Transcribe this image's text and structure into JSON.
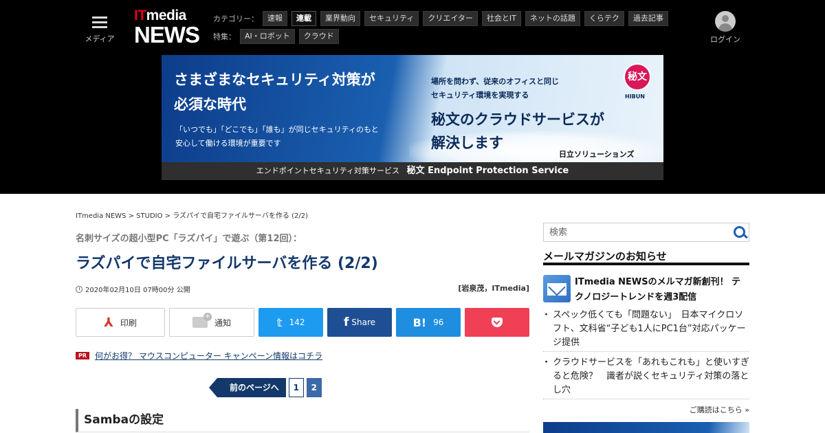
{
  "header": {
    "menu_label": "メディア",
    "logo_top_it": "IT",
    "logo_top_rest": "media",
    "logo_bottom": "NEWS",
    "category_label": "カテゴリー：",
    "categories": [
      "速報",
      "連載",
      "業界動向",
      "セキュリティ",
      "クリエイター",
      "社会とIT",
      "ネットの話題",
      "くらテク",
      "過去記事"
    ],
    "active_category": "連載",
    "feature_label": "特集：",
    "features": [
      "AI・ロボット",
      "クラウド"
    ],
    "login_label": "ログイン"
  },
  "banner": {
    "head1": "さまざまなセキュリティ対策が",
    "head2": "必須な時代",
    "sub1": "「いつでも」「どこでも」「誰も」が同じセキュリティのもと",
    "sub2": "安心して働ける環境が重要です",
    "right1": "場所を問わず、従来のオフィスと同じ",
    "right2": "セキュリティ環境を実現する",
    "right3": "秘文のクラウドサービスが",
    "right4": "解決します",
    "company": "日立ソリューションズ",
    "seal": "秘文",
    "seal_text": "HIBUN",
    "foot_small": "エンドポイントセキュリティ対策サービス",
    "foot_big": "秘文 Endpoint Protection Service"
  },
  "breadcrumb": {
    "items": [
      "ITmedia NEWS",
      "STUDIO",
      "ラズパイで自宅ファイルサーバを作る (2/2)"
    ],
    "sep": " > "
  },
  "article": {
    "series": "名刺サイズの超小型PC「ラズパイ」で遊ぶ（第12回）：",
    "title": "ラズパイで自宅ファイルサーバを作る (2/2)",
    "date": "2020年02月10日 07時00分 公開",
    "author": "[岩泉茂，ITmedia]",
    "pr_badge": "PR",
    "pr_text": "何がお得？ マウスコンピューター キャンペーン情報はコチラ",
    "section_title": "Sambaの設定"
  },
  "share": {
    "print_label": "印刷",
    "notify_label": "通知",
    "twitter_count": "142",
    "facebook_label": "Share",
    "hatena_mark": "B!",
    "hatena_count": "96",
    "pdf_glyph": "⅄",
    "twitter_glyph": "𝕥",
    "facebook_glyph": "f"
  },
  "pager": {
    "prev_label": "前のページへ",
    "pages": [
      "1",
      "2"
    ],
    "current": "2"
  },
  "sidebar": {
    "search_placeholder": "検索",
    "mm_title": "メールマガジンのお知らせ",
    "mm_feature": "ITmedia NEWSのメルマガ新創刊！ テクノロジートレンドを週3配信",
    "mm_items": [
      "スペック低くても「問題ない」　日本マイクロソフト、文科省“子ども1人にPC1台”対応パッケージ提供",
      "クラウドサービスを「あれもこれも」と使いすぎると危険？　識者が説くセキュリティ対策の落とし穴"
    ],
    "subscribe": "ご購読はこちら »"
  }
}
